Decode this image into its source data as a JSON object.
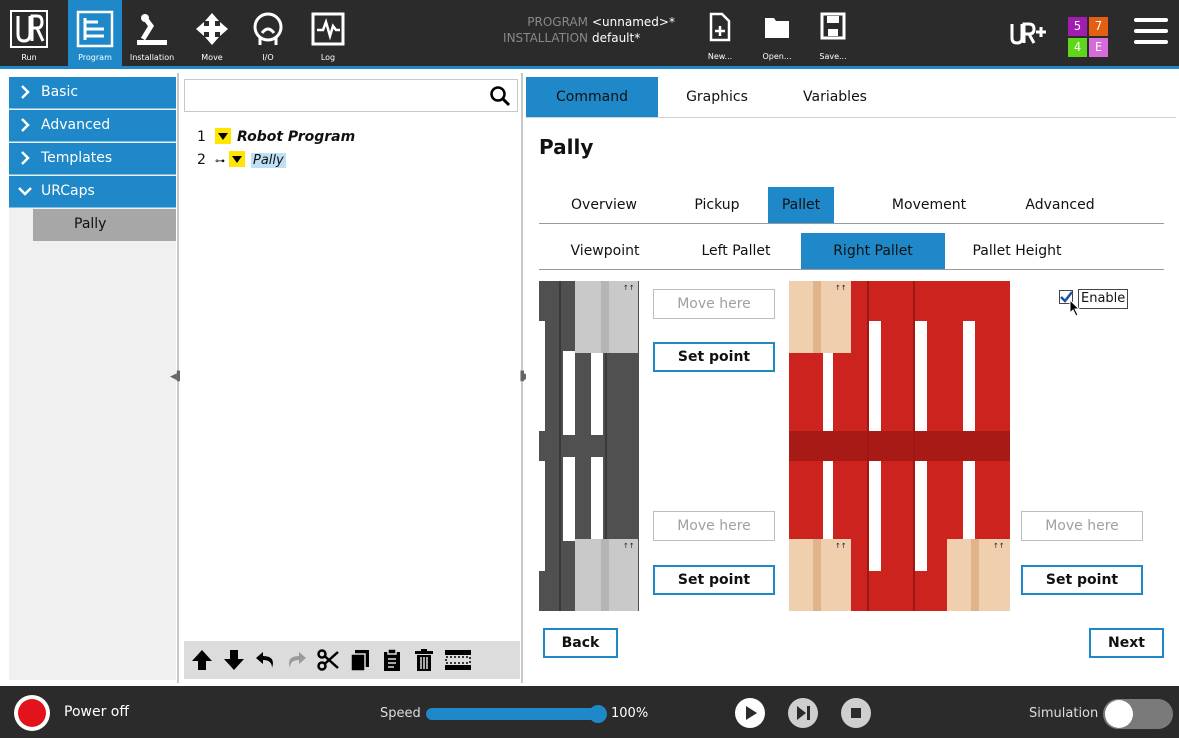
{
  "topbar": {
    "nav": [
      {
        "label": "Run",
        "icon": "ur-logo-icon"
      },
      {
        "label": "Program",
        "icon": "program-icon"
      },
      {
        "label": "Installation",
        "icon": "installation-icon"
      },
      {
        "label": "Move",
        "icon": "move-icon"
      },
      {
        "label": "I/O",
        "icon": "io-icon"
      },
      {
        "label": "Log",
        "icon": "log-icon"
      }
    ],
    "program_key": "PROGRAM",
    "program_value": "<unnamed>*",
    "installation_key": "INSTALLATION",
    "installation_value": "default*",
    "file": {
      "new": "New...",
      "open": "Open...",
      "save": "Save..."
    },
    "counters": [
      "5",
      "7",
      "4",
      "E"
    ],
    "counter_colors": [
      "#a21caf",
      "#e35f12",
      "#5fd61a",
      "#d66bd9"
    ]
  },
  "sidebar": {
    "items": [
      {
        "label": "Basic",
        "expanded": false
      },
      {
        "label": "Advanced",
        "expanded": false
      },
      {
        "label": "Templates",
        "expanded": false
      },
      {
        "label": "URCaps",
        "expanded": true
      }
    ],
    "sub_item": "Pally"
  },
  "tree": {
    "search_placeholder": "",
    "lines": [
      {
        "num": "1",
        "label": "Robot Program"
      },
      {
        "num": "2",
        "label": "Pally"
      }
    ]
  },
  "right": {
    "tabs": [
      "Command",
      "Graphics",
      "Variables"
    ],
    "title": "Pally",
    "section_tabs": [
      "Overview",
      "Pickup",
      "Pallet",
      "Movement",
      "Advanced"
    ],
    "pallet_tabs": [
      "Viewpoint",
      "Left Pallet",
      "Right Pallet",
      "Pallet Height"
    ],
    "move_here": "Move here",
    "set_point": "Set point",
    "enable_label": "Enable",
    "enable_checked": true,
    "back": "Back",
    "next": "Next"
  },
  "bottombar": {
    "power": "Power off",
    "speed_label": "Speed",
    "speed_value": "100%",
    "speed_percent": 100,
    "simulation": "Simulation",
    "simulation_on": false
  },
  "colors": {
    "accent": "#1e88c8",
    "pallet_right": "#cd231e",
    "pallet_left": "#505050"
  }
}
